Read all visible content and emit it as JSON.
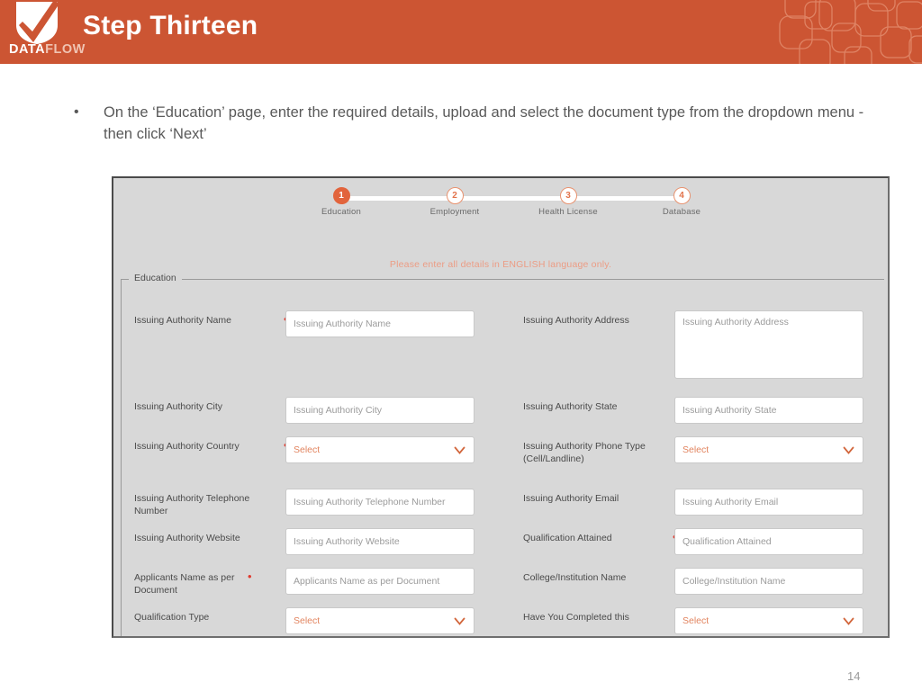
{
  "colors": {
    "brand_orange": "#cc5533",
    "step_active": "#e2643c",
    "select_text": "#e2845f",
    "required_red": "#e03a2f",
    "notice_text": "#ec9c84",
    "shot_bg": "#d8d8d8"
  },
  "header": {
    "title": "Step Thirteen",
    "logo_primary": "DATA",
    "logo_secondary": "FLOW"
  },
  "bullet": {
    "marker": "•",
    "text": "On the ‘Education’ page, enter the required details, upload and select the document type from the dropdown menu - then click ‘Next’"
  },
  "screenshot": {
    "stepper": [
      {
        "number": "1",
        "label": "Education",
        "active": true
      },
      {
        "number": "2",
        "label": "Employment",
        "active": false
      },
      {
        "number": "3",
        "label": "Health License",
        "active": false
      },
      {
        "number": "4",
        "label": "Database",
        "active": false
      }
    ],
    "notice": "Please enter all details in ENGLISH language only.",
    "fieldset_legend": "Education",
    "fields_left": [
      {
        "label": "Issuing Authority Name",
        "placeholder": "Issuing Authority Name",
        "type": "text",
        "required": true
      },
      {
        "label": "Issuing Authority City",
        "placeholder": "Issuing Authority City",
        "type": "text",
        "required": false
      },
      {
        "label": "Issuing Authority Country",
        "placeholder": "Select",
        "type": "select",
        "required": true
      },
      {
        "label": "Issuing Authority Telephone Number",
        "placeholder": "Issuing Authority Telephone Number",
        "type": "text",
        "required": false
      },
      {
        "label": "Issuing Authority Website",
        "placeholder": "Issuing Authority Website",
        "type": "text",
        "required": false
      },
      {
        "label": "Applicants Name as per Document",
        "placeholder": "Applicants Name as per Document",
        "type": "text",
        "required": true
      },
      {
        "label": "Qualification Type",
        "placeholder": "Select",
        "type": "select",
        "required": false
      }
    ],
    "fields_right": [
      {
        "label": "Issuing Authority Address",
        "placeholder": "Issuing Authority Address",
        "type": "textarea",
        "required": false
      },
      {
        "label": "Issuing Authority State",
        "placeholder": "Issuing Authority State",
        "type": "text",
        "required": false
      },
      {
        "label": "Issuing Authority Phone Type (Cell/Landline)",
        "placeholder": "Select",
        "type": "select",
        "required": false
      },
      {
        "label": "Issuing Authority Email",
        "placeholder": "Issuing Authority Email",
        "type": "text",
        "required": false
      },
      {
        "label": "Qualification Attained",
        "placeholder": "Qualification Attained",
        "type": "text",
        "required": true
      },
      {
        "label": "College/Institution Name",
        "placeholder": "College/Institution Name",
        "type": "text",
        "required": false
      },
      {
        "label": "Have You Completed this",
        "placeholder": "Select",
        "type": "select",
        "required": false
      }
    ]
  },
  "footer": {
    "page_number": "14"
  }
}
